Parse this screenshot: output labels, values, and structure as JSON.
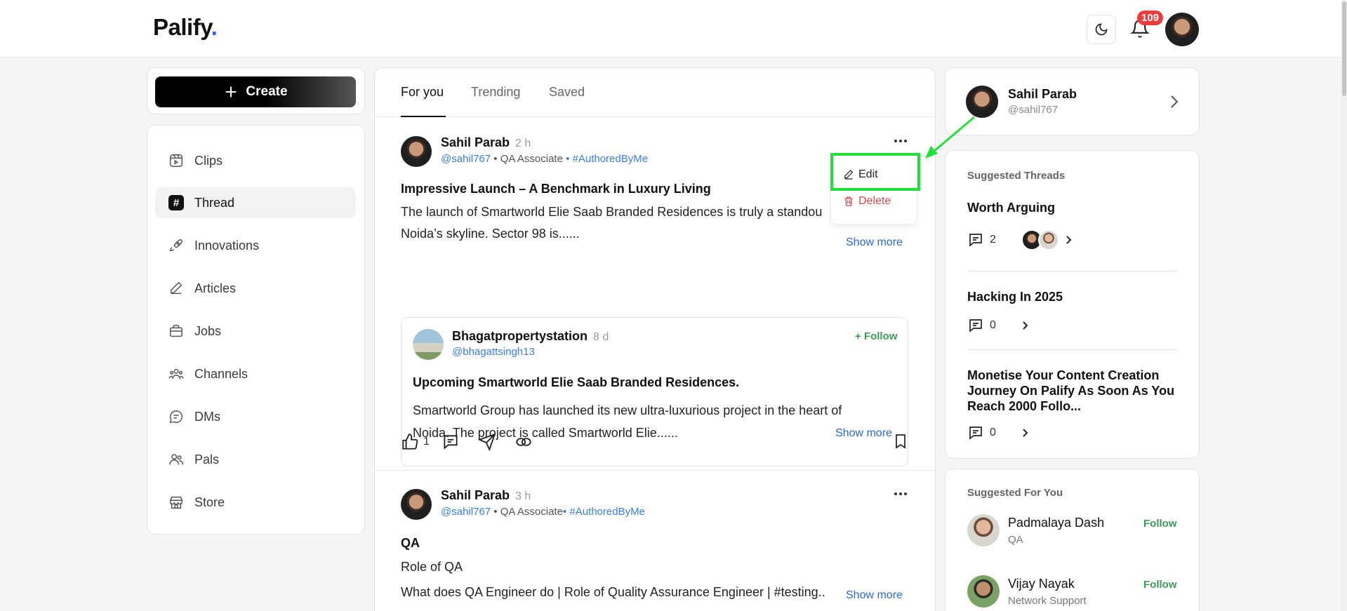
{
  "header": {
    "logo": "Palify",
    "logo_dot": ".",
    "notification_count": "109"
  },
  "left_sidebar": {
    "create_label": "Create",
    "nav": [
      {
        "label": "Clips",
        "icon": "clips-icon"
      },
      {
        "label": "Thread",
        "icon": "hash-icon",
        "active": true
      },
      {
        "label": "Innovations",
        "icon": "rocket-icon"
      },
      {
        "label": "Articles",
        "icon": "pencil-icon"
      },
      {
        "label": "Jobs",
        "icon": "briefcase-icon"
      },
      {
        "label": "Channels",
        "icon": "people-icon"
      },
      {
        "label": "DMs",
        "icon": "chat-icon"
      },
      {
        "label": "Pals",
        "icon": "pals-icon"
      },
      {
        "label": "Store",
        "icon": "store-icon"
      }
    ]
  },
  "feed": {
    "tabs": [
      {
        "label": "For you",
        "active": true
      },
      {
        "label": "Trending"
      },
      {
        "label": "Saved"
      }
    ],
    "post1": {
      "author": "Sahil Parab",
      "time": "2 h",
      "handle": "@sahil767",
      "role": "QA Associate",
      "tag": "#AuthoredByMe",
      "title": "Impressive Launch – A Benchmark in Luxury Living",
      "body_line1": "The launch of Smartworld Elie Saab Branded Residences is truly a standou",
      "body_line2": "Noida’s skyline. Sector 98 is......",
      "show_more": "Show more",
      "quote": {
        "author": "Bhagatpropertystation",
        "time": "8 d",
        "handle": "@bhagattsingh13",
        "follow": "+ Follow",
        "title": "Upcoming Smartworld Elie Saab Branded Residences.",
        "body_line1": "Smartworld Group has launched its new ultra-luxurious project in the heart of",
        "body_line2": "Noida. The project is called Smartworld Elie......",
        "show_more": "Show more"
      },
      "like_count": "1"
    },
    "post2": {
      "author": "Sahil Parab",
      "time": "3 h",
      "handle": "@sahil767",
      "role": "QA Associate",
      "tag": "• #AuthoredByMe",
      "title": "QA",
      "body": "Role of QA",
      "link": "What does QA Engineer do | Role of Quality Assurance Engineer | #testing..",
      "show_more": "Show more"
    }
  },
  "post_menu": {
    "edit": "Edit",
    "delete": "Delete"
  },
  "right_sidebar": {
    "profile": {
      "name": "Sahil Parab",
      "handle": "@sahil767"
    },
    "suggested_threads_title": "Suggested Threads",
    "threads": [
      {
        "title": "Worth Arguing",
        "comments": "2"
      },
      {
        "title": "Hacking In 2025",
        "comments": "0"
      },
      {
        "title": "Monetise Your Content Creation Journey On Palify As Soon As You Reach 2000 Follo...",
        "comments": "0"
      }
    ],
    "suggested_for_you_title": "Suggested For You",
    "people": [
      {
        "name": "Padmalaya Dash",
        "role": "QA",
        "follow": "Follow"
      },
      {
        "name": "Vijay Nayak",
        "role": "Network Support",
        "follow": "Follow"
      }
    ]
  },
  "colors": {
    "accent_green": "#3f9a5a",
    "link_blue": "#3b7ddd",
    "badge_red": "#ef3b3b",
    "highlight_green": "#22e03a"
  }
}
